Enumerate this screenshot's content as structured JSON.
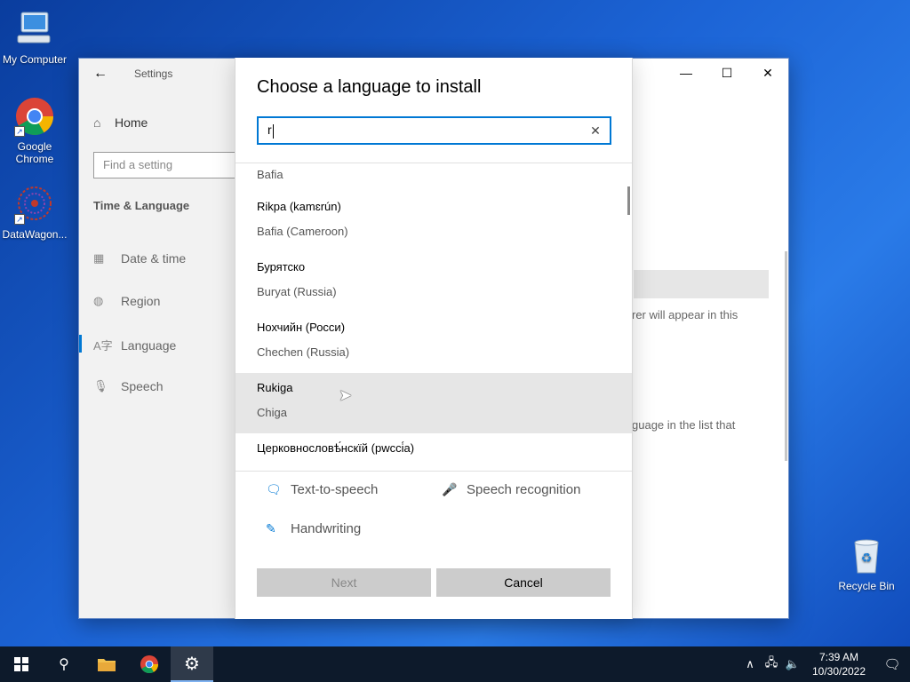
{
  "desktop": {
    "icons": [
      {
        "label": "My Computer"
      },
      {
        "label": "Google Chrome"
      },
      {
        "label": "DataWagon..."
      },
      {
        "label": "Recycle Bin"
      }
    ]
  },
  "settings": {
    "app_title": "Settings",
    "home": "Home",
    "search_placeholder": "Find a setting",
    "section": "Time & Language",
    "nav": [
      "Date & time",
      "Region",
      "Language",
      "Speech"
    ],
    "bg_text_1": "rer will appear in this",
    "bg_text_2": "guage in the list that"
  },
  "dialog": {
    "title": "Choose a language to install",
    "search_value": "r",
    "languages": [
      {
        "name": "",
        "sub": "Bafia"
      },
      {
        "name": "Rikpa (kamɛrún)",
        "sub": "Bafia (Cameroon)"
      },
      {
        "name": "Бурятско",
        "sub": "Buryat (Russia)"
      },
      {
        "name": "Нохчийн (Росси)",
        "sub": "Chechen (Russia)"
      },
      {
        "name": "Rukiga",
        "sub": "Chiga"
      },
      {
        "name": "Церковнословѣ́нскїй (рwссі́а)",
        "sub": ""
      }
    ],
    "features": [
      "Text-to-speech",
      "Speech recognition",
      "Handwriting"
    ],
    "next": "Next",
    "cancel": "Cancel"
  },
  "taskbar": {
    "time": "7:39 AM",
    "date": "10/30/2022"
  },
  "colors": {
    "accent": "#0078d4",
    "taskbar": "#0d1a2b"
  }
}
